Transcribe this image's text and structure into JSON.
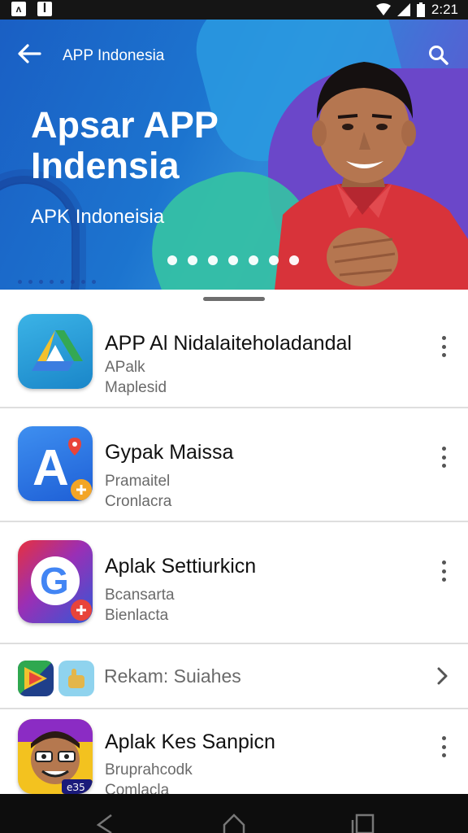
{
  "status_bar": {
    "time": "2:21",
    "left_icons": [
      "notification-icon",
      "app-notification-icon"
    ],
    "right_icons": [
      "wifi-icon",
      "signal-icon",
      "battery-icon"
    ]
  },
  "header": {
    "title": "APP Indonesia",
    "back_icon": "arrow-left-icon",
    "search_icon": "search-icon"
  },
  "banner": {
    "headline": "Apsar APP Indensia",
    "subline": "APK Indoneisia",
    "page_count": 7
  },
  "apps": [
    {
      "name": "APP Al Nidalaiteholadandal",
      "line1": "APalk",
      "line2": "Maplesid",
      "icon": "drive-triangle-icon"
    },
    {
      "name": "Gypak Maissa",
      "line1": "Pramaitel",
      "line2": "Cronlacra",
      "icon": "letter-a-map-icon"
    },
    {
      "name": "Aplak Settiurkicn",
      "line1": "Bcansarta",
      "line2": "Bienlacta",
      "icon": "g-logo-icon"
    }
  ],
  "recommend": {
    "label": "Rekam: Suiahes",
    "icons": [
      "green-arrow-app-icon",
      "blue-hand-app-icon"
    ]
  },
  "last_app": {
    "name": "Aplak Kes Sanpicn",
    "line1": "Bruprahcodk",
    "line2": "Comlacla",
    "icon": "cartoon-face-icon",
    "badge": "еЗ5"
  },
  "nav_bar": {
    "buttons": [
      "back-nav-icon",
      "home-nav-icon",
      "recents-nav-icon"
    ]
  },
  "colors": {
    "banner_blue": "#1c74cf",
    "banner_purple": "#6b47c9",
    "banner_teal": "#35c3a3",
    "shirt_red": "#d8333a"
  }
}
